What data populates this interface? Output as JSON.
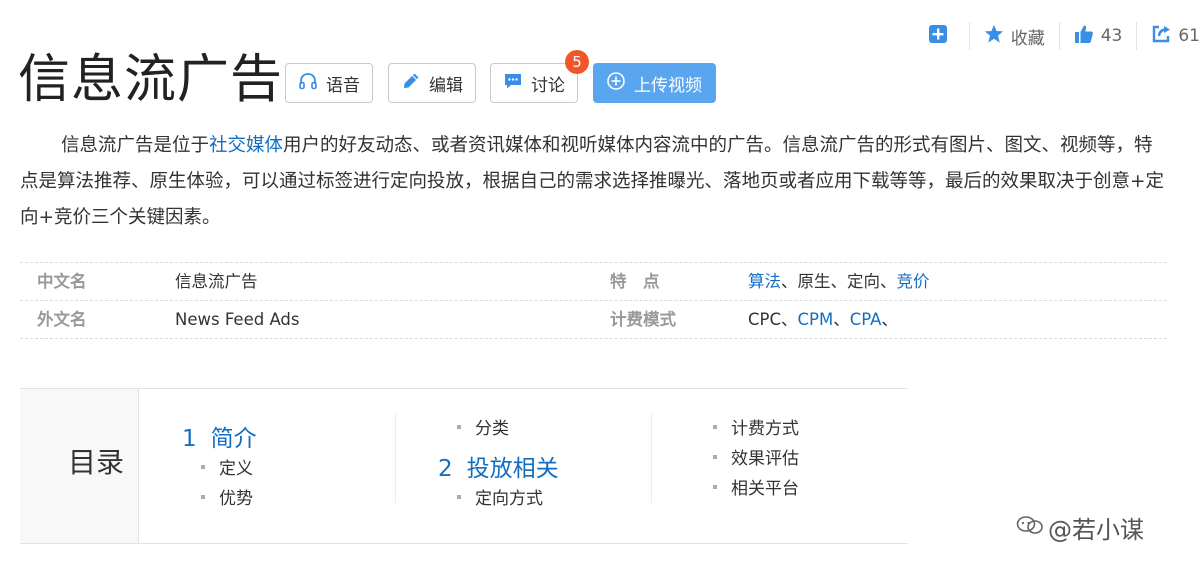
{
  "toolbar": {
    "favorite_label": "收藏",
    "like_count": "43",
    "share_count": "61"
  },
  "title": "信息流广告",
  "actions": {
    "voice_label": "语音",
    "edit_label": "编辑",
    "discuss_label": "讨论",
    "discuss_badge": "5",
    "upload_label": "上传视频"
  },
  "description": {
    "part1": "信息流广告是位于",
    "link": "社交媒体",
    "part2": "用户的好友动态、或者资讯媒体和视听媒体内容流中的广告。信息流广告的形式有图片、图文、视频等，特点是算法推荐、原生体验，可以通过标签进行定向投放，根据自己的需求选择推曝光、落地页或者应用下载等等，最后的效果取决于创意+定向+竞价三个关键因素。"
  },
  "info": {
    "chinese_name_label": "中文名",
    "chinese_name_value": "信息流广告",
    "features_label": "特　点",
    "features": {
      "f1": "算法",
      "sep1": "、原生、定向、",
      "f2": "竞价"
    },
    "foreign_name_label": "外文名",
    "foreign_name_value": "News Feed Ads",
    "billing_label": "计费模式",
    "billing": {
      "b1": "CPC、",
      "b2": "CPM",
      "sep": "、",
      "b3": "CPA",
      "tail": "、"
    }
  },
  "toc": {
    "title": "目录",
    "sections": [
      {
        "num": "1",
        "label": "简介",
        "items": [
          "定义",
          "优势"
        ]
      },
      {
        "num": "2",
        "label": "投放相关",
        "items": [
          "分类",
          "定向方式",
          "计费方式",
          "效果评估",
          "相关平台"
        ]
      }
    ]
  },
  "watermark": "@若小谋",
  "colors": {
    "link": "#136ec2",
    "primary_button": "#5aa5f0",
    "badge": "#f25527"
  }
}
